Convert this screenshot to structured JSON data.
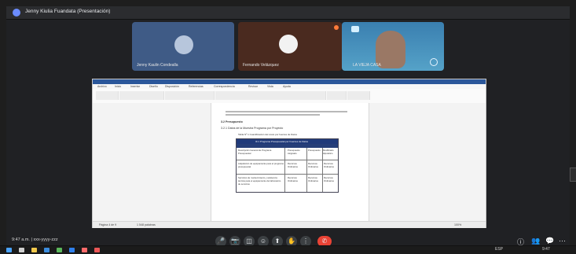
{
  "window": {
    "title": "Jenny Kiulia Fuandata (Presentación)"
  },
  "participants": [
    {
      "name": "Jenny Kaulin Condealla"
    },
    {
      "name": "Fernando Velázquez"
    },
    {
      "name": "LA VIEJA CASA"
    }
  ],
  "document": {
    "window_title": "",
    "menu": [
      "Archivo",
      "Inicio",
      "Insertar",
      "Diseño",
      "Disposición",
      "Referencias",
      "Correspondencia",
      "Revisar",
      "Vista",
      "Ayuda"
    ],
    "heading_1": "3.2 Presupuesto",
    "heading_2": "3.2.1 Datos de la Muestra Programa por Proyecto",
    "table": {
      "title": "Tabla Nº 1 Cuantificación del costo por fuentes de Datos",
      "subtitle": "III.1 Programa Presupuestal por Fuentes de Datos",
      "headers": [
        "Descripción General de Programa Presupuestal",
        "Presupuesto Asignado",
        "Presupuesto",
        "Modificado Hipotético"
      ],
      "rows": [
        [
          "Adquisición de equipamiento para el programa presupuestal",
          "Recursos Ordinarios",
          "Recursos Ordinarios",
          "Recursos Ordinarios"
        ],
        [
          "Servicios de mantenimiento y asistencia técnica para el equipamiento del laboratorio de servicios",
          "Recursos Ordinarios",
          "Recursos Ordinarios",
          "Recursos Ordinarios"
        ]
      ]
    }
  },
  "status_bar": {
    "left": "Página 4 de 9",
    "words": "1 548 palabras",
    "zoom": "100%"
  },
  "meeting_bar": {
    "time": "9:47 a.m.",
    "code": "xxx-yyyy-zzz"
  },
  "taskbar": {
    "time": "9:47",
    "lang": "ESP"
  }
}
